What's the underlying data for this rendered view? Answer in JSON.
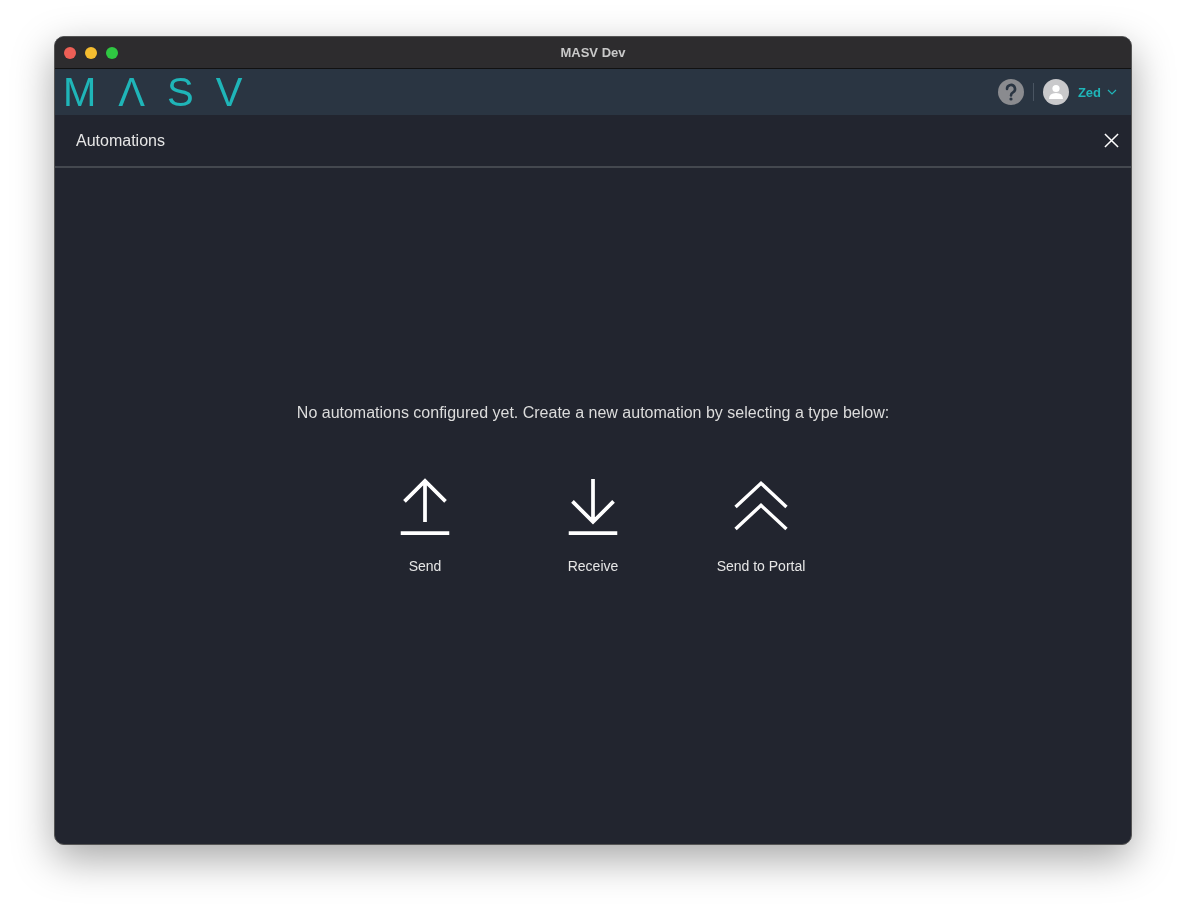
{
  "window": {
    "title": "MASV Dev"
  },
  "header": {
    "logo": "MΛSV",
    "user": {
      "name": "Zed"
    }
  },
  "panel": {
    "title": "Automations"
  },
  "empty_message": "No automations configured yet. Create a new automation by selecting a type below:",
  "automation_types": [
    {
      "kind": "send",
      "label": "Send"
    },
    {
      "kind": "receive",
      "label": "Receive"
    },
    {
      "kind": "portal",
      "label": "Send to Portal"
    }
  ]
}
